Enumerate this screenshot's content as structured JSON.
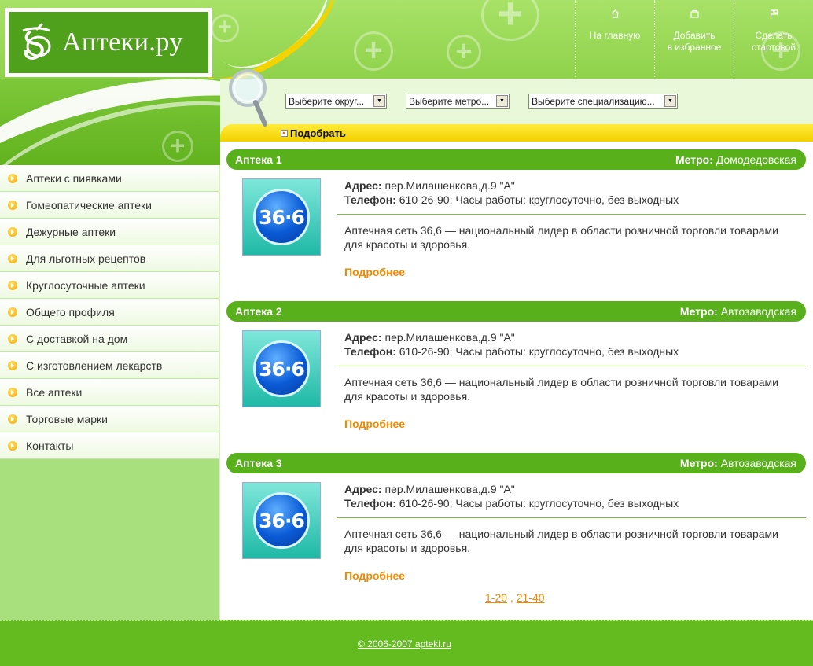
{
  "header": {
    "logo_text": "Аптеки.ру",
    "nav": [
      {
        "label_1": "На главную",
        "label_2": "",
        "icon": "home-icon"
      },
      {
        "label_1": "Добавить",
        "label_2": "в избранное",
        "icon": "favorites-icon"
      },
      {
        "label_1": "Сделать",
        "label_2": "стартовой",
        "icon": "flag-icon"
      }
    ]
  },
  "search": {
    "district_placeholder": "Выберите округ...",
    "metro_placeholder": "Выберите метро...",
    "specialization_placeholder": "Выберите специализацию...",
    "submit_label": "Подобрать"
  },
  "sidebar": {
    "items": [
      {
        "label": "Аптеки с пиявками"
      },
      {
        "label": "Гомеопатические аптеки"
      },
      {
        "label": "Дежурные аптеки"
      },
      {
        "label": "Для льготных рецептов"
      },
      {
        "label": "Круглосуточные аптеки"
      },
      {
        "label": "Общего профиля"
      },
      {
        "label": "С доставкой на дом"
      },
      {
        "label": "С изготовлением лекарств"
      },
      {
        "label": "Все аптеки"
      },
      {
        "label": "Торговые марки"
      },
      {
        "label": "Контакты"
      }
    ]
  },
  "labels": {
    "metro": "Метро:",
    "address": "Адрес:",
    "phone": "Телефон:",
    "more": "Подробнее"
  },
  "pharmacies": [
    {
      "name": "Аптека 1",
      "metro": "Домодедовская",
      "logo_text": "36·6",
      "address": "пер.Милашенкова,д.9 \"А\"",
      "phone": "610-26-90; Часы работы: круглосуточно, без выходных",
      "description": "Аптечная сеть 36,6 — национальный лидер в области розничной торговли товарами для красоты и здоровья."
    },
    {
      "name": "Аптека 2",
      "metro": "Автозаводская",
      "logo_text": "36·6",
      "address": "пер.Милашенкова,д.9 \"А\"",
      "phone": "610-26-90; Часы работы: круглосуточно, без выходных",
      "description": "Аптечная сеть 36,6 — национальный лидер в области розничной торговли товарами для красоты и здоровья."
    },
    {
      "name": "Аптека 3",
      "metro": "Автозаводская",
      "logo_text": "36·6",
      "address": "пер.Милашенкова,д.9 \"А\"",
      "phone": "610-26-90; Часы работы: круглосуточно, без выходных",
      "description": "Аптечная сеть 36,6 — национальный лидер в области розничной торговли товарами для красоты и здоровья."
    }
  ],
  "pager": {
    "page_1": "1-20",
    "separator": ",",
    "page_2": "21-40"
  },
  "footer": {
    "copyright": "© 2006-2007 apteki.ru"
  },
  "colors": {
    "brand_green": "#58b01b",
    "accent_orange": "#f28a00",
    "accent_yellow": "#f3cf00"
  }
}
